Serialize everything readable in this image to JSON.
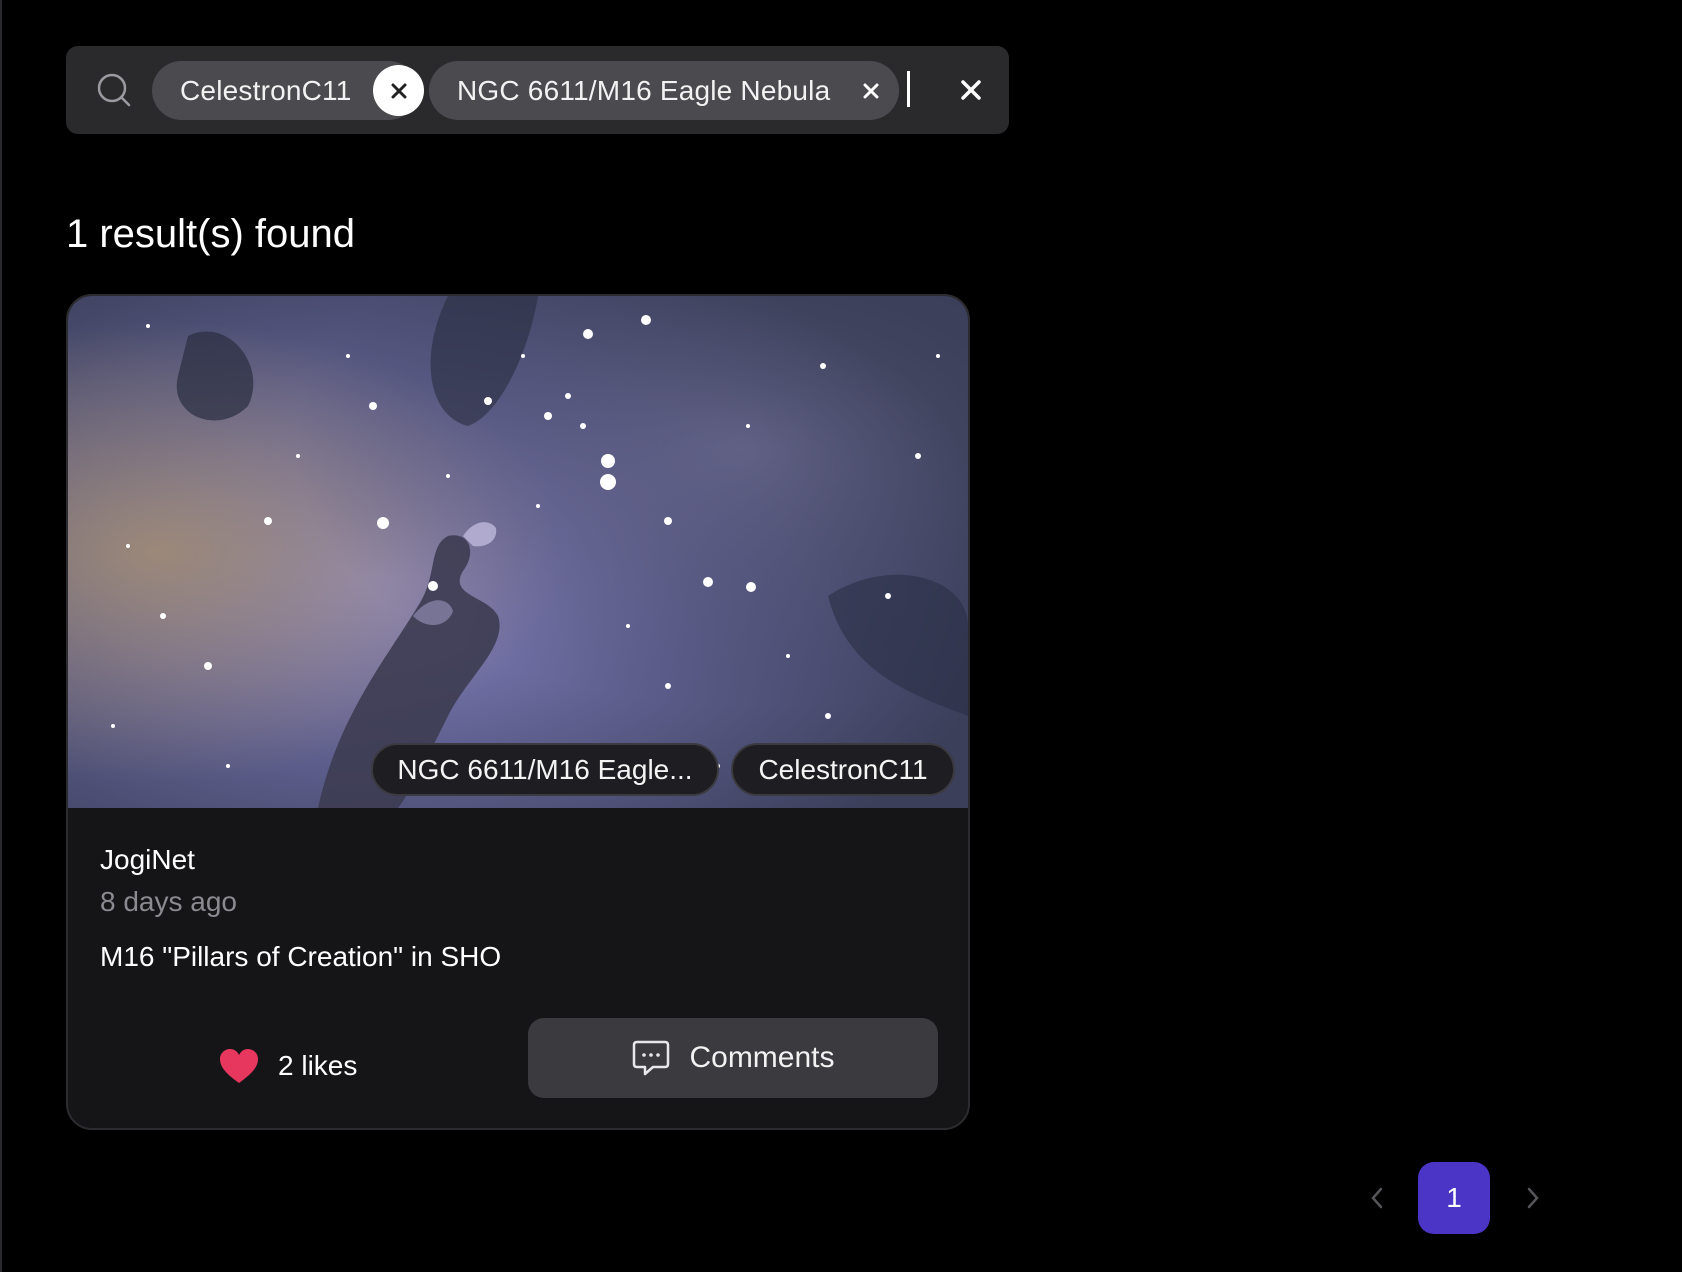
{
  "search": {
    "chips": [
      {
        "label": "CelestronC11"
      },
      {
        "label": "NGC 6611/M16 Eagle Nebula"
      }
    ]
  },
  "results": {
    "count_text": "1 result(s) found"
  },
  "card": {
    "image_tags": [
      "NGC 6611/M16 Eagle...",
      "CelestronC11"
    ],
    "author": "JogiNet",
    "time_ago": "8 days ago",
    "title": "M16 \"Pillars of Creation\" in SHO",
    "likes_text": "2 likes",
    "comments_label": "Comments"
  },
  "pagination": {
    "current_page": "1"
  },
  "colors": {
    "accent": "#4a35c7",
    "heart": "#e8375e",
    "background": "#000000",
    "card": "#151518"
  },
  "icons": {
    "search": "search-icon",
    "remove_chip": "close-icon",
    "clear": "close-icon",
    "like": "heart-icon",
    "comment": "comment-bubble-icon",
    "prev": "chevron-left-icon",
    "next": "chevron-right-icon"
  }
}
